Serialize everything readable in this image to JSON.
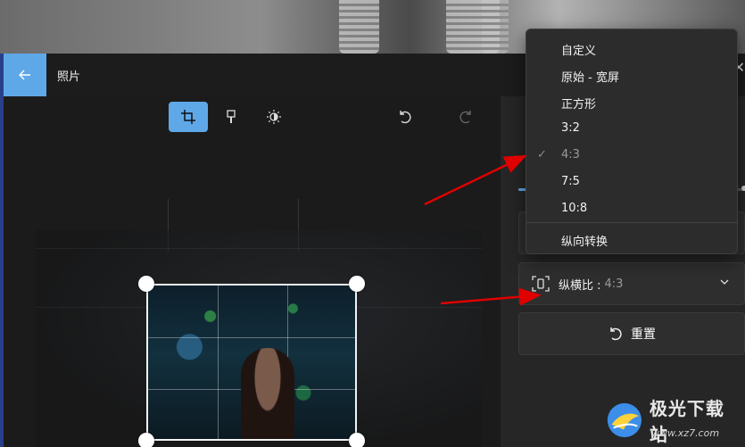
{
  "app": {
    "title": "照片"
  },
  "menu": {
    "items": [
      "自定义",
      "原始 - 宽屏",
      "正方形",
      "3:2",
      "4:3",
      "7:5",
      "10:8"
    ],
    "selected_index": 4,
    "footer_item": "纵向转换"
  },
  "aspect": {
    "label": "纵横比 :",
    "value": "4:3"
  },
  "reset": {
    "label": "重置"
  },
  "watermark": {
    "brand": "极光下载站",
    "url": "www.xz7.com"
  },
  "colors": {
    "accent": "#5fa8e8",
    "arrow": "#e00000"
  }
}
